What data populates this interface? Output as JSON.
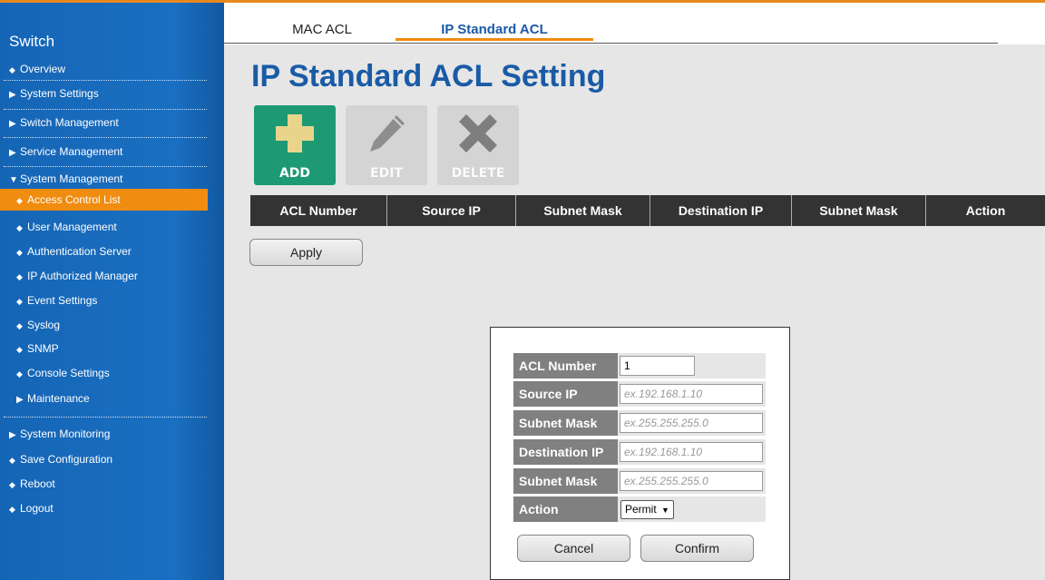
{
  "sidebar": {
    "title": "Switch",
    "items": [
      {
        "label": "Overview",
        "mark": "◆"
      },
      {
        "label": "System Settings",
        "mark": "▶"
      },
      {
        "label": "Switch Management",
        "mark": "▶"
      },
      {
        "label": "Service Management",
        "mark": "▶"
      },
      {
        "label": "System Management",
        "mark": "▼"
      },
      {
        "label": "Access Control List",
        "mark": "◆",
        "active": true
      },
      {
        "label": "User Management",
        "mark": "◆"
      },
      {
        "label": "Authentication Server",
        "mark": "◆"
      },
      {
        "label": "IP Authorized Manager",
        "mark": "◆"
      },
      {
        "label": "Event Settings",
        "mark": "◆"
      },
      {
        "label": "Syslog",
        "mark": "◆"
      },
      {
        "label": "SNMP",
        "mark": "◆"
      },
      {
        "label": "Console Settings",
        "mark": "◆"
      },
      {
        "label": "Maintenance",
        "mark": "▶"
      },
      {
        "label": "System Monitoring",
        "mark": "▶"
      },
      {
        "label": "Save Configuration",
        "mark": "◆"
      },
      {
        "label": "Reboot",
        "mark": "◆"
      },
      {
        "label": "Logout",
        "mark": "◆"
      }
    ]
  },
  "tabs": {
    "mac": "MAC ACL",
    "ip": "IP Standard ACL"
  },
  "page_title": "IP Standard ACL Setting",
  "toolbar": {
    "add": "ADD",
    "edit": "EDIT",
    "delete": "DELETE"
  },
  "table": {
    "headers": [
      "ACL Number",
      "Source IP",
      "Subnet Mask",
      "Destination IP",
      "Subnet Mask",
      "Action"
    ]
  },
  "apply_label": "Apply",
  "dialog": {
    "acl_number_label": "ACL Number",
    "acl_number_value": "1",
    "source_ip_label": "Source IP",
    "source_ip_placeholder": "ex.192.168.1.10",
    "src_mask_label": "Subnet Mask",
    "src_mask_placeholder": "ex.255.255.255.0",
    "dest_ip_label": "Destination IP",
    "dest_ip_placeholder": "ex.192.168.1.10",
    "dst_mask_label": "Subnet Mask",
    "dst_mask_placeholder": "ex.255.255.255.0",
    "action_label": "Action",
    "action_value": "Permit",
    "cancel_label": "Cancel",
    "confirm_label": "Confirm"
  },
  "colors": {
    "accent": "#f08c10",
    "sidebar": "#1a6fc2",
    "title": "#1a5ba6",
    "add_button": "#1d9a73",
    "table_header": "#333333"
  }
}
